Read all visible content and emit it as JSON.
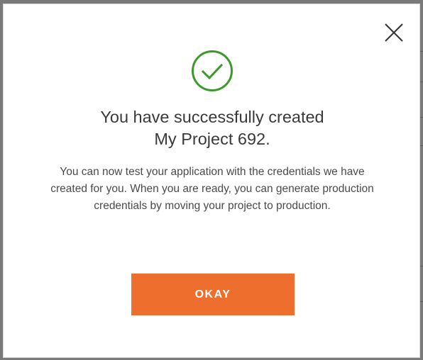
{
  "dialog": {
    "title_line1": "You have successfully created",
    "title_line2": "My Project 692.",
    "message": "You can now test your application with the credentials we have created for you. When you are ready, you can generate production credentials by moving your project to production.",
    "ok_label": "OKAY",
    "close_icon": "close-icon",
    "status_icon": "check-circle-icon"
  },
  "colors": {
    "accent": "#ee6e2d",
    "success": "#3a9a2a",
    "title_text": "#3a3a3a",
    "body_text": "#4a4a4a"
  }
}
